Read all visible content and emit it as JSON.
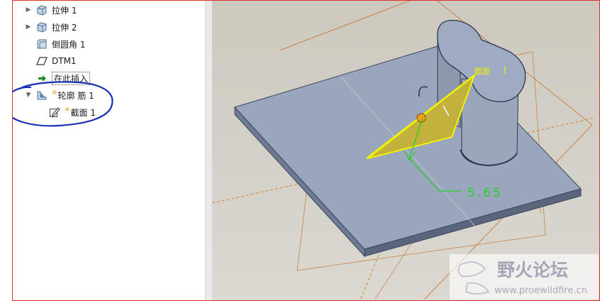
{
  "tree": {
    "items": [
      {
        "label": "拉伸 1",
        "icon": "extrude-icon",
        "expandable": true
      },
      {
        "label": "拉伸 2",
        "icon": "extrude-icon",
        "expandable": true
      },
      {
        "label": "倒圆角 1",
        "icon": "round-icon",
        "expandable": false
      },
      {
        "label": "DTM1",
        "icon": "datum-plane-icon",
        "expandable": false
      },
      {
        "label": "在此插入",
        "icon": "insert-here-arrow-icon",
        "expandable": false
      },
      {
        "label": "轮廓 筋 1",
        "icon": "profile-rib-icon",
        "expandable": true,
        "expanded": true
      },
      {
        "label": "截面 1",
        "icon": "sketch-section-icon",
        "expandable": false
      }
    ]
  },
  "viewport": {
    "section_label": "截面",
    "dimension_value": "5.65",
    "watermark_title": "野火论坛",
    "watermark_url": "www.proewildfire.cn"
  },
  "colors": {
    "annotation_circle": "#1a2fb5",
    "rib_fill": "#c9b640",
    "rib_edge": "#f2f200",
    "dimension": "#2bcc2b",
    "datum_orange": "#c87a3a",
    "part_gray": "#8c99b0"
  }
}
